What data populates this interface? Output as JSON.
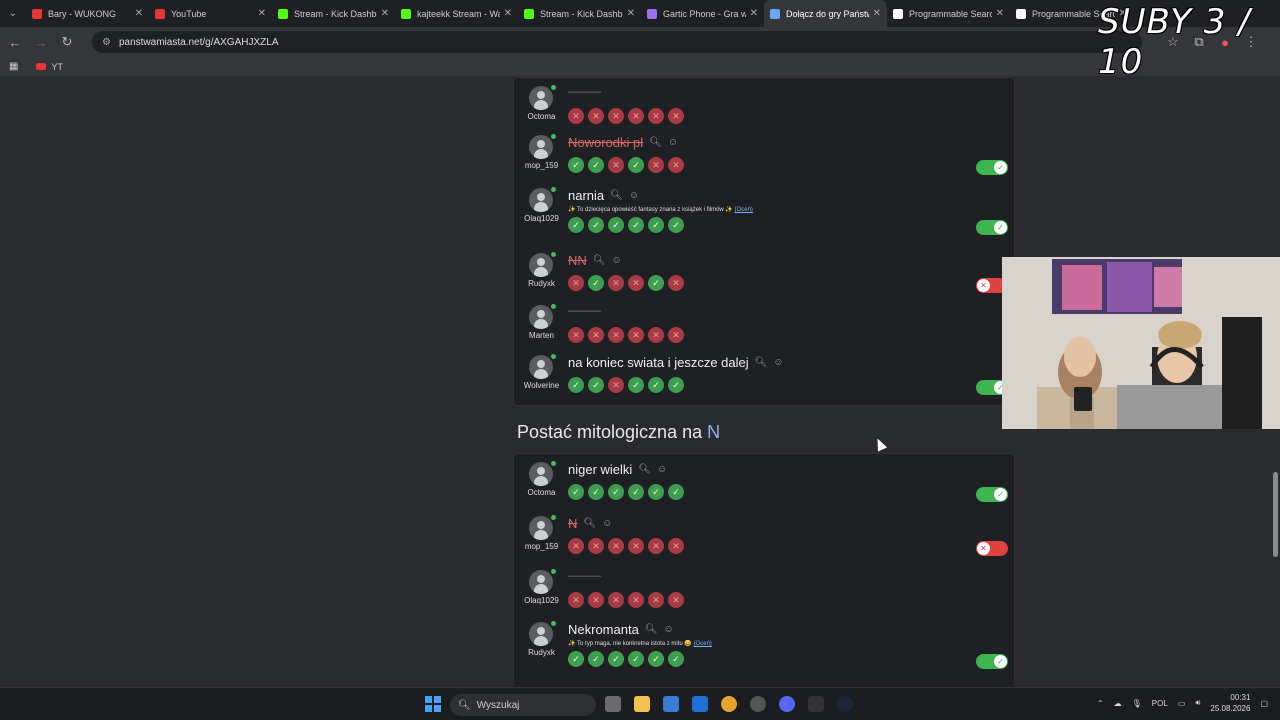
{
  "browser": {
    "tabs": [
      {
        "label": "Bary - WUKONG",
        "color": "#e5363a"
      },
      {
        "label": "YouTube",
        "color": "#e5363a"
      },
      {
        "label": "Stream - Kick Dashbo",
        "color": "#53fc18"
      },
      {
        "label": "kajteekk Stream - Wa",
        "color": "#53fc18"
      },
      {
        "label": "Stream - Kick Dashbo",
        "color": "#53fc18"
      },
      {
        "label": "Gartic Phone - Gra w",
        "color": "#a070f0"
      },
      {
        "label": "Dołącz do gry Państw",
        "color": "#6aa8ff"
      },
      {
        "label": "Programmable Searc",
        "color": "#ffffff"
      },
      {
        "label": "Programmable Searc",
        "color": "#ffffff"
      }
    ],
    "url": "panstwamiasta.net/g/AXGAHJXZLA",
    "bookmark": "YT"
  },
  "section1": {
    "rows": [
      {
        "user": "Octoma",
        "answer": "",
        "struck": false,
        "desc": "",
        "votes": [
          "no",
          "no",
          "no",
          "no",
          "no",
          "no"
        ],
        "toggle": "none"
      },
      {
        "user": "mop_159",
        "answer": "Noworodki pl",
        "struck": true,
        "desc": "",
        "votes": [
          "ok",
          "ok",
          "no",
          "ok",
          "no",
          "no"
        ],
        "toggle": "on"
      },
      {
        "user": "Olaq1029",
        "answer": "narnia",
        "struck": false,
        "desc": "✨ To dziecięca opowieść fantasy znana z książek i filmów ✨",
        "desc_more": "(Oceń)",
        "votes": [
          "ok",
          "ok",
          "ok",
          "ok",
          "ok",
          "ok"
        ],
        "toggle": "on"
      },
      {
        "user": "Rudyxk",
        "answer": "NN",
        "struck": true,
        "desc": "",
        "votes": [
          "no",
          "ok",
          "no",
          "no",
          "ok",
          "no"
        ],
        "toggle": "off"
      },
      {
        "user": "Marten",
        "answer": "",
        "struck": false,
        "desc": "",
        "votes": [
          "no",
          "no",
          "no",
          "no",
          "no",
          "no"
        ],
        "toggle": "none"
      },
      {
        "user": "Wolverine",
        "answer": "na koniec swiata i jeszcze dalej",
        "struck": false,
        "desc": "",
        "votes": [
          "ok",
          "ok",
          "no",
          "ok",
          "ok",
          "ok"
        ],
        "toggle": "on"
      }
    ]
  },
  "section2": {
    "title": "Postać mitologiczna na",
    "letter": "N",
    "rows": [
      {
        "user": "Octoma",
        "answer": "niger wielki",
        "struck": false,
        "desc": "",
        "votes": [
          "ok",
          "ok",
          "ok",
          "ok",
          "ok",
          "ok"
        ],
        "toggle": "on"
      },
      {
        "user": "mop_159",
        "answer": "N",
        "struck": true,
        "desc": "",
        "votes": [
          "no",
          "no",
          "no",
          "no",
          "no",
          "no"
        ],
        "toggle": "off"
      },
      {
        "user": "Olaq1029",
        "answer": "",
        "struck": false,
        "desc": "",
        "votes": [
          "no",
          "no",
          "no",
          "no",
          "no",
          "no"
        ],
        "toggle": "none"
      },
      {
        "user": "Rudyxk",
        "answer": "Nekromanta",
        "struck": false,
        "desc": "✨ To typ maga, nie konkretna istota z mitu 😄",
        "desc_more": "(Oceń)",
        "votes": [
          "ok",
          "ok",
          "ok",
          "ok",
          "ok",
          "ok"
        ],
        "toggle": "on"
      }
    ]
  },
  "overlay": {
    "text": "SUBY 3 / 10"
  },
  "taskbar": {
    "search": "Wyszukaj",
    "lang": "POL",
    "time": "00:31",
    "date": "25.08.2026"
  }
}
